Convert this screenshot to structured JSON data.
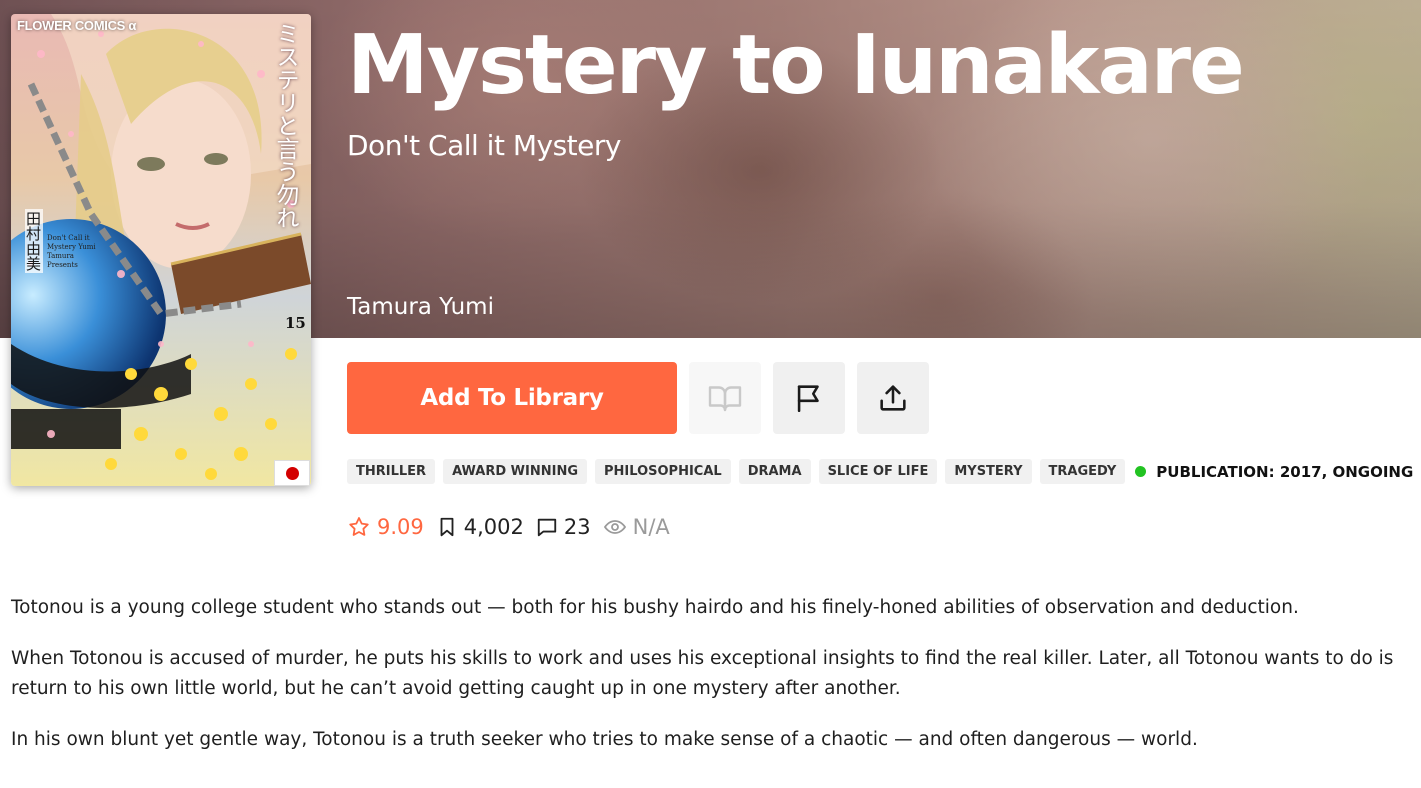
{
  "manga": {
    "title": "Mystery to Iunakare",
    "subtitle": "Don't Call it Mystery",
    "author": "Tamura Yumi"
  },
  "cover": {
    "publisher": "FLOWER COMICS α",
    "vertical_title": "ミステリと言う勿れ",
    "author_vertical": "田村由美",
    "english_text": "Don't Call it Mystery Yumi Tamura Presents",
    "volume": "15",
    "country_flag_icon": "japan-flag-icon"
  },
  "actions": {
    "add_to_library": "Add To Library",
    "read_icon": "book-open-icon",
    "report_icon": "flag-icon",
    "share_icon": "share-icon"
  },
  "tags": [
    "THRILLER",
    "AWARD WINNING",
    "PHILOSOPHICAL",
    "DRAMA",
    "SLICE OF LIFE",
    "MYSTERY",
    "TRAGEDY"
  ],
  "publication": {
    "label": "PUBLICATION: 2017, ONGOING",
    "status_color": "#22c322"
  },
  "stats": {
    "rating": "9.09",
    "follows": "4,002",
    "comments": "23",
    "views": "N/A"
  },
  "description": [
    "Totonou is a young college student who stands out — both for his bushy hairdo and his finely-honed abilities of observation and deduction.",
    "When Totonou is accused of murder, he puts his skills to work and uses his exceptional insights to find the real killer. Later, all Totonou wants to do is return to his own little world, but he can’t avoid getting caught up in one mystery after another.",
    "In his own blunt yet gentle way, Totonou is a truth seeker who tries to make sense of a chaotic — and often dangerous — world."
  ],
  "colors": {
    "accent": "#ff6740",
    "tag_bg": "#f1f1f1"
  }
}
